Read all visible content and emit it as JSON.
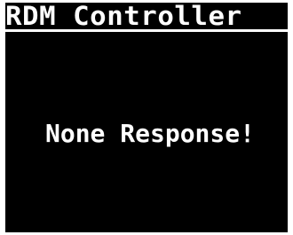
{
  "app": {
    "title": "RDM Controller"
  },
  "screen": {
    "message": "None Response!"
  },
  "colors": {
    "background": "#000000",
    "foreground": "#ffffff",
    "frame": "#ffffff"
  }
}
